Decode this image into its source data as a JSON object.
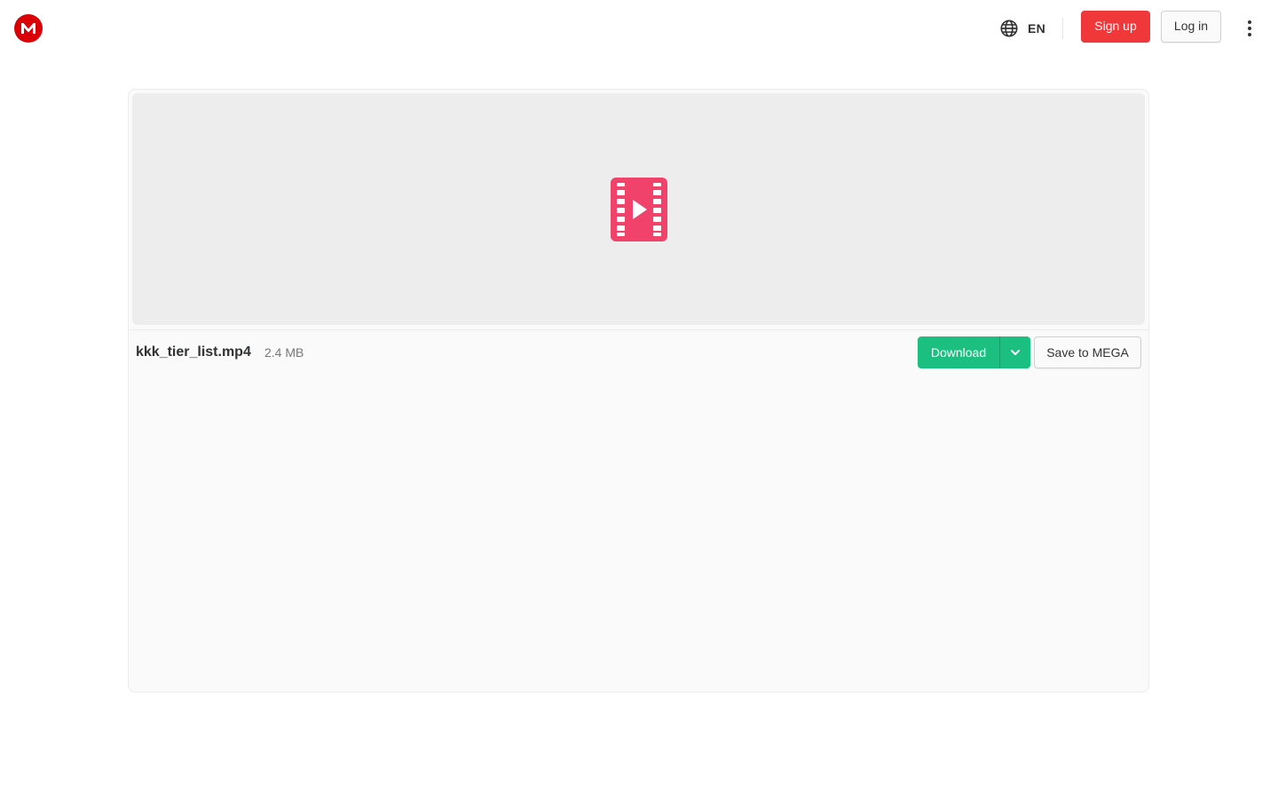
{
  "header": {
    "logo_icon": "mega-logo-icon",
    "language_icon": "globe-icon",
    "language_code": "EN",
    "signup_label": "Sign up",
    "login_label": "Log in",
    "more_icon": "vertical-dots-icon"
  },
  "file": {
    "preview_icon": "video-file-icon",
    "name": "kkk_tier_list.mp4",
    "size": "2.4 MB"
  },
  "actions": {
    "download_label": "Download",
    "download_options_icon": "chevron-down-icon",
    "save_label": "Save to MEGA"
  },
  "colors": {
    "brand_red": "#d90007",
    "signup_red": "#f0373a",
    "download_green": "#1bbf7f",
    "video_icon_pink": "#f0426a"
  }
}
